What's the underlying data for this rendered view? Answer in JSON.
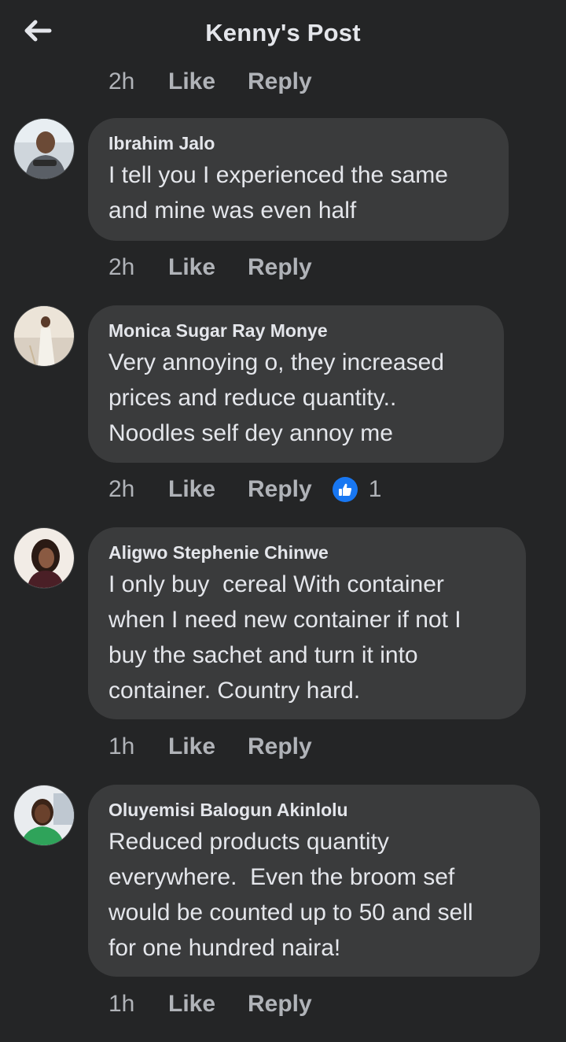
{
  "header": {
    "title": "Kenny's Post",
    "back_icon": "arrow-left-icon"
  },
  "top_meta": {
    "time": "2h",
    "like": "Like",
    "reply": "Reply"
  },
  "comments": [
    {
      "author": "Ibrahim Jalo",
      "lines": [
        "I tell you I experienced the same",
        "and mine was even half"
      ],
      "time": "2h",
      "like": "Like",
      "reply": "Reply"
    },
    {
      "author": "Monica Sugar Ray Monye",
      "lines": [
        "Very annoying o, they increased",
        "prices and reduce quantity..",
        "Noodles self dey annoy me"
      ],
      "time": "2h",
      "like": "Like",
      "reply": "Reply",
      "reaction": {
        "icon": "thumbs-up-icon",
        "count": "1",
        "color": "#1877f2"
      }
    },
    {
      "author": "Aligwo Stephenie Chinwe",
      "lines": [
        "I only buy  cereal With container",
        "when I need new container if not I",
        "buy the sachet and turn it into",
        "container. Country hard."
      ],
      "time": "1h",
      "like": "Like",
      "reply": "Reply"
    },
    {
      "author": "Oluyemisi Balogun Akinlolu",
      "lines": [
        "Reduced products quantity",
        "everywhere.  Even the broom sef",
        "would be counted up to 50 and sell",
        "for one hundred naira!"
      ],
      "time": "1h",
      "like": "Like",
      "reply": "Reply"
    }
  ],
  "colors": {
    "background": "#242526",
    "bubble": "#3a3b3c",
    "primary_text": "#e4e6eb",
    "secondary_text": "#b0b3b8",
    "accent": "#1877f2"
  }
}
